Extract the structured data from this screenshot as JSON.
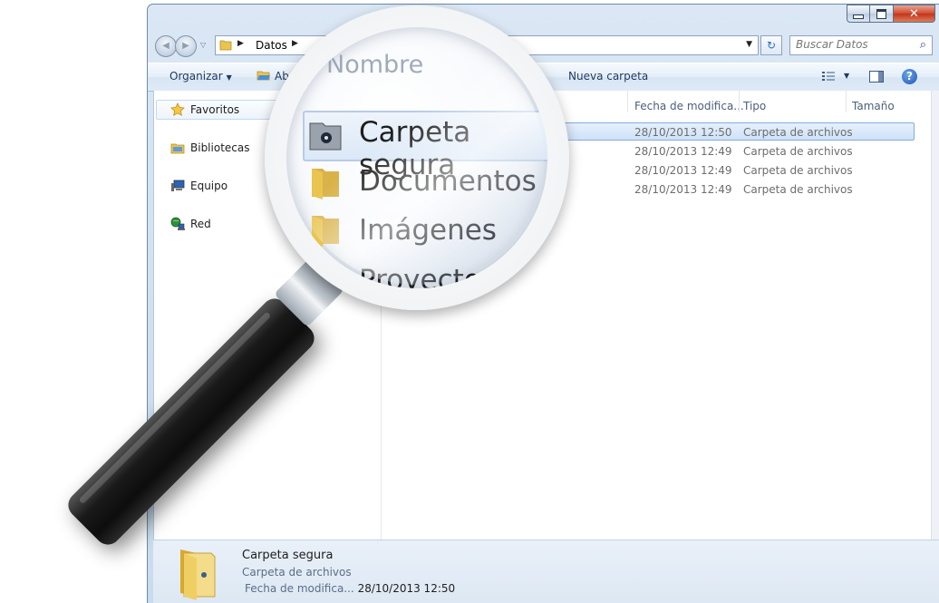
{
  "address": {
    "crumb": "Datos"
  },
  "search": {
    "placeholder": "Buscar Datos"
  },
  "toolbar": {
    "organize": "Organizar",
    "open": "Abrir",
    "new_folder": "Nueva carpeta"
  },
  "nav": {
    "favorites": "Favoritos",
    "libraries": "Bibliotecas",
    "computer": "Equipo",
    "network": "Red"
  },
  "columns": {
    "name": "Nombre",
    "date": "Fecha de modifica...",
    "type": "Tipo",
    "size": "Tamaño"
  },
  "files": [
    {
      "name": "Carpeta segura",
      "date": "28/10/2013 12:50",
      "type": "Carpeta de archivos"
    },
    {
      "name": "Documentos",
      "date": "28/10/2013 12:49",
      "type": "Carpeta de archivos"
    },
    {
      "name": "Imágenes",
      "date": "28/10/2013 12:49",
      "type": "Carpeta de archivos"
    },
    {
      "name": "Proyectos",
      "date": "28/10/2013 12:49",
      "type": "Carpeta de archivos"
    }
  ],
  "details": {
    "name": "Carpeta segura",
    "type": "Carpeta de archivos",
    "date_label": "Fecha de modifica...",
    "date": "28/10/2013 12:50"
  },
  "colors": {
    "accent": "#2a6cc9",
    "selection": "#cfe2f8",
    "folder": "#e9c450"
  },
  "icons": [
    "minimize-icon",
    "maximize-icon",
    "close-icon",
    "back-icon",
    "forward-icon",
    "folder-icon",
    "refresh-icon",
    "search-icon",
    "star-icon",
    "library-icon",
    "computer-icon",
    "network-icon",
    "view-icon",
    "preview-pane-icon",
    "help-icon",
    "magnifying-glass-icon"
  ]
}
